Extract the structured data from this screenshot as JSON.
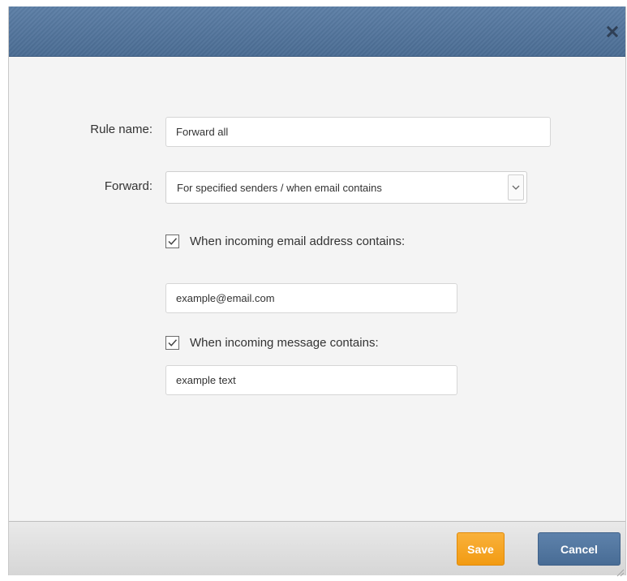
{
  "dialog": {
    "close_icon": "close-icon"
  },
  "form": {
    "rule_name": {
      "label": "Rule name:",
      "value": "Forward all"
    },
    "forward": {
      "label": "Forward:",
      "selected": "For specified senders / when email contains",
      "arrow_icon": "chevron-down-icon"
    },
    "email_condition": {
      "checked": true,
      "label": "When incoming email address contains:",
      "value": "example@email.com"
    },
    "message_condition": {
      "checked": true,
      "label": "When incoming message contains:",
      "value": "example text"
    }
  },
  "footer": {
    "save_label": "Save",
    "cancel_label": "Cancel"
  },
  "colors": {
    "titlebar": "#4f719a",
    "save": "#f4a51e",
    "cancel": "#4f729b",
    "panel": "#f4f4f4"
  }
}
